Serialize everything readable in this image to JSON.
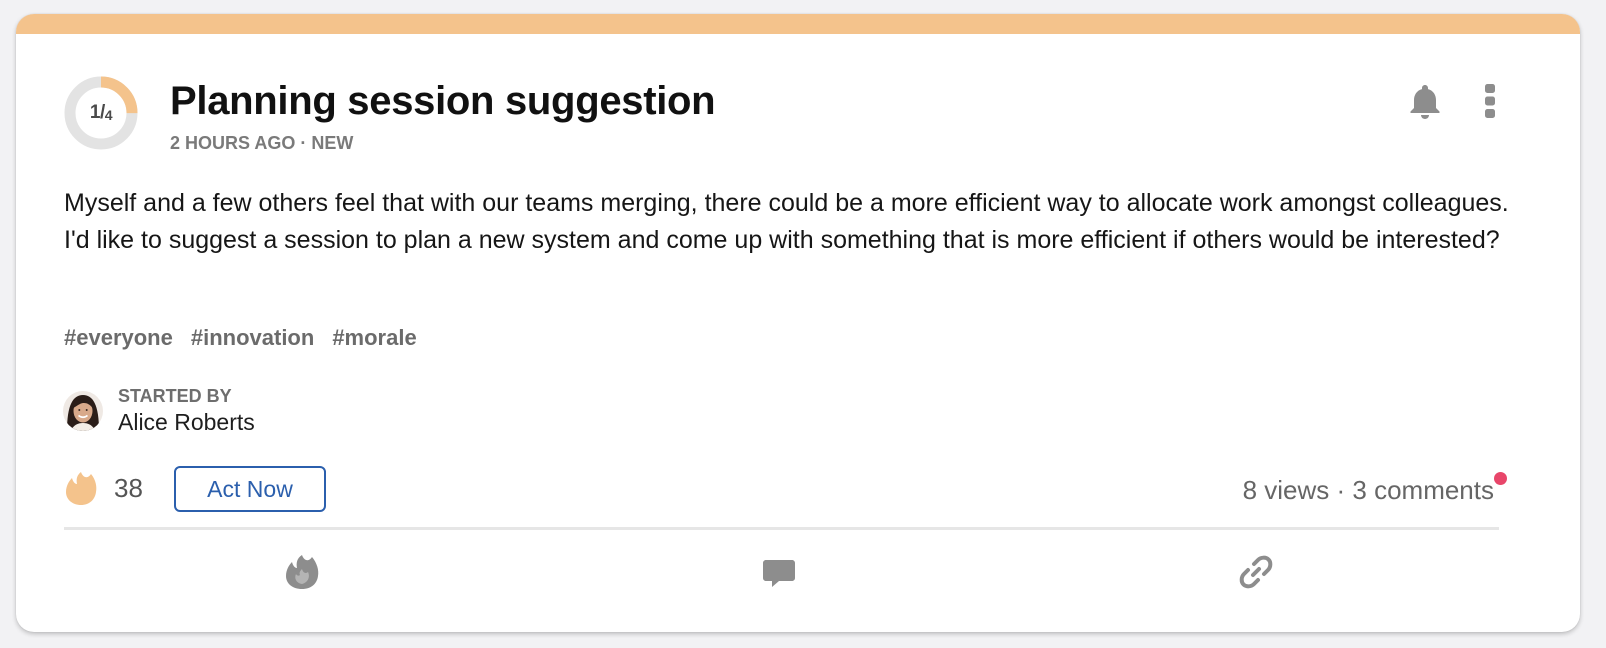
{
  "colors": {
    "accent": "#f4c38c",
    "track": "#e3e3e3",
    "link_blue": "#2b5fad",
    "notification": "#e8466a",
    "icon_grey": "#8d8d8d"
  },
  "post": {
    "progress": {
      "numerator": "1",
      "denominator": "4",
      "fraction": 0.25
    },
    "title": "Planning session suggestion",
    "meta": "2 HOURS AGO · NEW",
    "body": "Myself and a few others feel that with our teams merging, there could be a more efficient way to allocate work amongst colleagues. I'd like to suggest a session to plan a new system and come up with something that is more efficient if others would be interested?",
    "tags": [
      "#everyone",
      "#innovation",
      "#morale"
    ],
    "started_by_label": "STARTED BY",
    "author": "Alice Roberts",
    "fire_count": "38",
    "act_now_label": "Act Now",
    "views": "8 views",
    "separator": " · ",
    "comments": "3 comments"
  },
  "icons": {
    "bell": "bell-icon",
    "more": "more-vertical-icon",
    "fire": "fire-icon",
    "comment": "comment-icon",
    "link": "link-icon"
  }
}
